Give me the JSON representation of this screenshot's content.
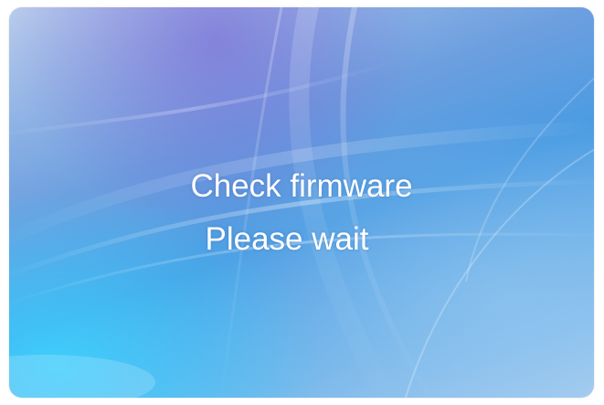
{
  "message": {
    "line1": "Check firmware",
    "line2": "Please wait"
  },
  "colors": {
    "background_primary": "#4a9be2",
    "background_accent_purple": "#7a5ad2",
    "background_accent_cyan": "#3cd2ff",
    "text": "#ffffff"
  }
}
